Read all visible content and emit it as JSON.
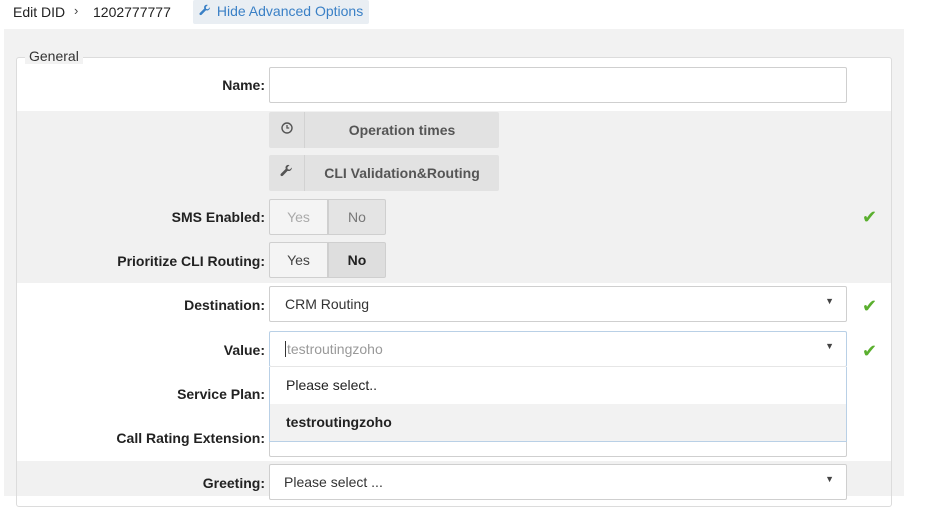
{
  "header": {
    "edit_label": "Edit DID",
    "separator": "›",
    "did_number": "1202777777",
    "advanced_button": "Hide Advanced Options"
  },
  "fieldset": {
    "legend": "General"
  },
  "fields": {
    "name": {
      "label": "Name:",
      "value": ""
    },
    "operation_times_button": "Operation times",
    "cli_validation_button": "CLI Validation&Routing",
    "sms_enabled": {
      "label": "SMS Enabled:",
      "yes": "Yes",
      "no": "No",
      "selected": "No"
    },
    "prioritize_cli": {
      "label": "Prioritize CLI Routing:",
      "yes": "Yes",
      "no": "No",
      "selected": "No"
    },
    "destination": {
      "label": "Destination:",
      "value": "CRM Routing"
    },
    "value": {
      "label": "Value:",
      "value": "testroutingzoho"
    },
    "service_plan": {
      "label": "Service Plan:"
    },
    "call_rating_extension": {
      "label": "Call Rating Extension:"
    },
    "greeting": {
      "label": "Greeting:",
      "value": "Please select ..."
    }
  },
  "value_dropdown": {
    "options": [
      "Please select..",
      "testroutingzoho"
    ],
    "highlighted": "testroutingzoho"
  },
  "icons": [
    "wrench-icon",
    "clock-icon",
    "wrench-icon",
    "check-icon",
    "chevron-down-icon"
  ],
  "colors": {
    "accent": "#3a80c6",
    "success": "#5aaf2e",
    "panel": "#f2f2f2"
  }
}
